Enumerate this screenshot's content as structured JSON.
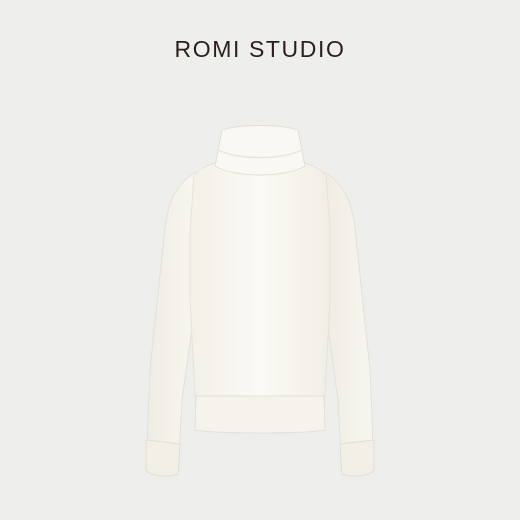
{
  "brand": {
    "name": "ROMI STUDIO"
  },
  "product": {
    "icon": "white-turtleneck-sweater",
    "color": "#fbf9f3"
  },
  "colors": {
    "background": "#eeeeec",
    "brand_text": "#2a1f1c"
  }
}
